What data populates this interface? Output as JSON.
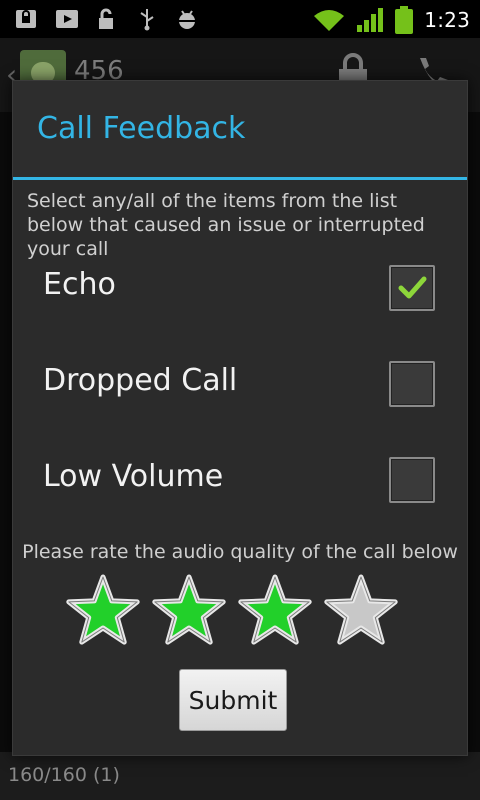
{
  "status_bar": {
    "time": "1:23",
    "icons": [
      "lock-download-icon",
      "youtube-icon",
      "unlock-icon",
      "usb-icon",
      "android-debug-icon",
      "wifi-icon",
      "signal-icon",
      "battery-icon"
    ]
  },
  "background_app": {
    "contact_number": "456",
    "footer_text": "160/160 (1)"
  },
  "dialog": {
    "title": "Call Feedback",
    "instructions": "Select any/all of the items from the list below that caused an issue or interrupted your call",
    "options": [
      {
        "label": "Echo",
        "checked": true
      },
      {
        "label": "Dropped Call",
        "checked": false
      },
      {
        "label": "Low Volume",
        "checked": false
      }
    ],
    "rating_prompt": "Please rate the audio quality of the call below",
    "rating": {
      "value": 3,
      "max": 4
    },
    "submit_label": "Submit"
  },
  "colors": {
    "accent": "#33b5e5",
    "star_on": "#22d02a",
    "star_off": "#c8c8c8",
    "check": "#8dd63a"
  }
}
